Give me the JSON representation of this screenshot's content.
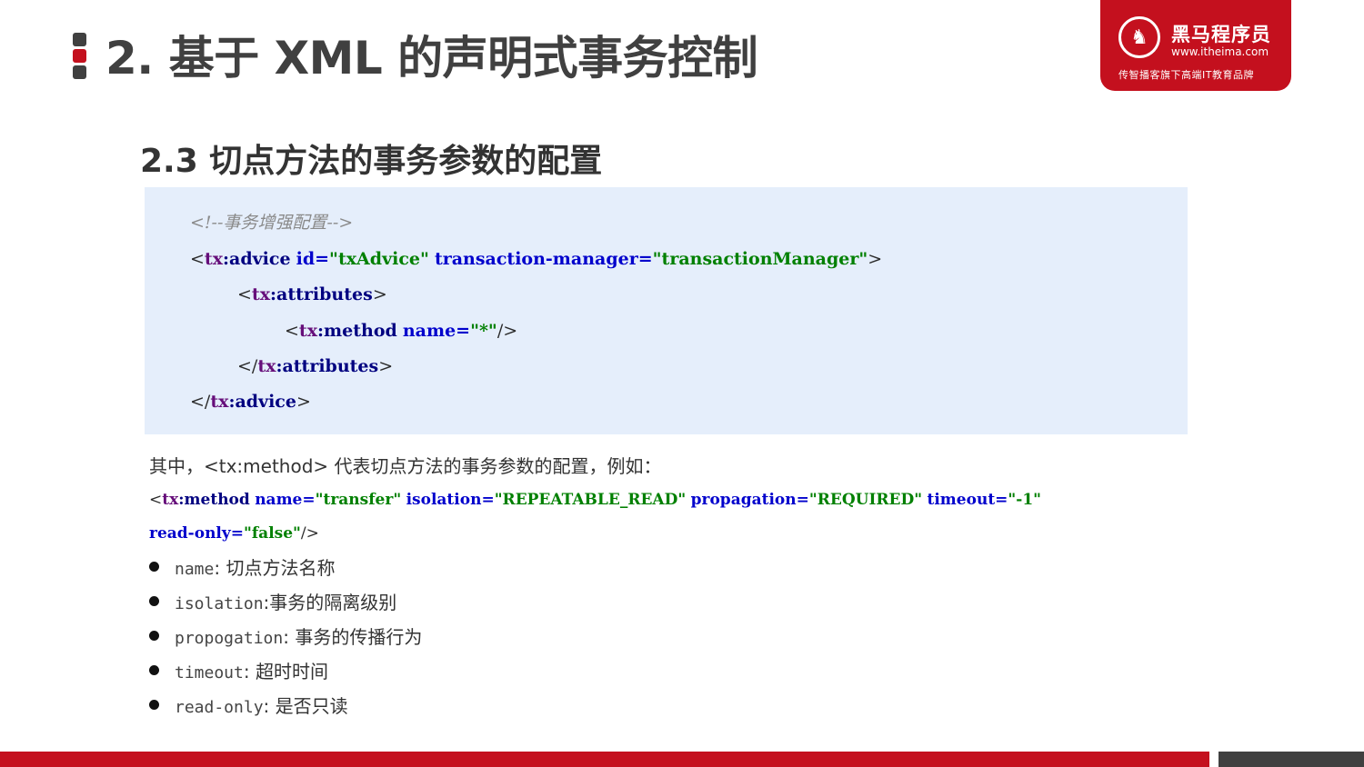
{
  "header": {
    "title": "2. 基于 XML 的声明式事务控制",
    "bar_colors": [
      "#404040",
      "#c4101e",
      "#404040"
    ]
  },
  "logo": {
    "icon": "horse-head-icon",
    "name_cn": "黑马程序员",
    "url": "www.itheima.com",
    "slogan": "传智播客旗下高端IT教育品牌",
    "color": "#c4101e"
  },
  "section": {
    "title": "2.3 切点方法的事务参数的配置"
  },
  "code": {
    "comment": "<!--事务增强配置-->",
    "advice_open": {
      "lt": "<",
      "ns": "tx",
      "colon": ":",
      "name": "advice",
      "attr1": "id",
      "eq1": "=",
      "val1": "\"txAdvice\"",
      "attr2": "transaction-manager",
      "eq2": "=",
      "val2": "\"transactionManager\"",
      "gt": ">"
    },
    "attributes_open": {
      "lt": "<",
      "ns": "tx",
      "colon": ":",
      "name": "attributes",
      "gt": ">"
    },
    "method": {
      "lt": "<",
      "ns": "tx",
      "colon": ":",
      "name": "method",
      "attr": "name",
      "eq": "=",
      "val": "\"*\"",
      "end": "/>"
    },
    "attributes_close": {
      "lt": "</",
      "ns": "tx",
      "colon": ":",
      "name": "attributes",
      "gt": ">"
    },
    "advice_close": {
      "lt": "</",
      "ns": "tx",
      "colon": ":",
      "name": "advice",
      "gt": ">"
    }
  },
  "description": "其中，<tx:method> 代表切点方法的事务参数的配置，例如：",
  "example": {
    "lt": "<",
    "ns": "tx",
    "colon": ":",
    "name": "method",
    "a1": "name",
    "v1": "\"transfer\"",
    "a2": "isolation",
    "v2": "\"REPEATABLE_READ\"",
    "a3": "propagation",
    "v3": "\"REQUIRED\"",
    "a4": "timeout",
    "v4": "\"-1\"",
    "a5": "read-only",
    "v5": "\"false\"",
    "eq": "=",
    "end": "/>"
  },
  "bullets": [
    {
      "key": "name",
      "sep": ": ",
      "text": "切点方法名称"
    },
    {
      "key": "isolation",
      "sep": ":",
      "text": "事务的隔离级别"
    },
    {
      "key": "propogation",
      "sep": ": ",
      "text": "事务的传播行为"
    },
    {
      "key": "timeout",
      "sep": ": ",
      "text": "超时时间"
    },
    {
      "key": "read-only",
      "sep": ": ",
      "text": "是否只读"
    }
  ],
  "colors": {
    "brand_red": "#c4101e",
    "code_bg": "#e5eefb",
    "namespace": "#660e7a",
    "element": "#000080",
    "attribute": "#0000cc",
    "value": "#008000",
    "comment": "#8a8a8a",
    "footer_gray": "#404040"
  }
}
